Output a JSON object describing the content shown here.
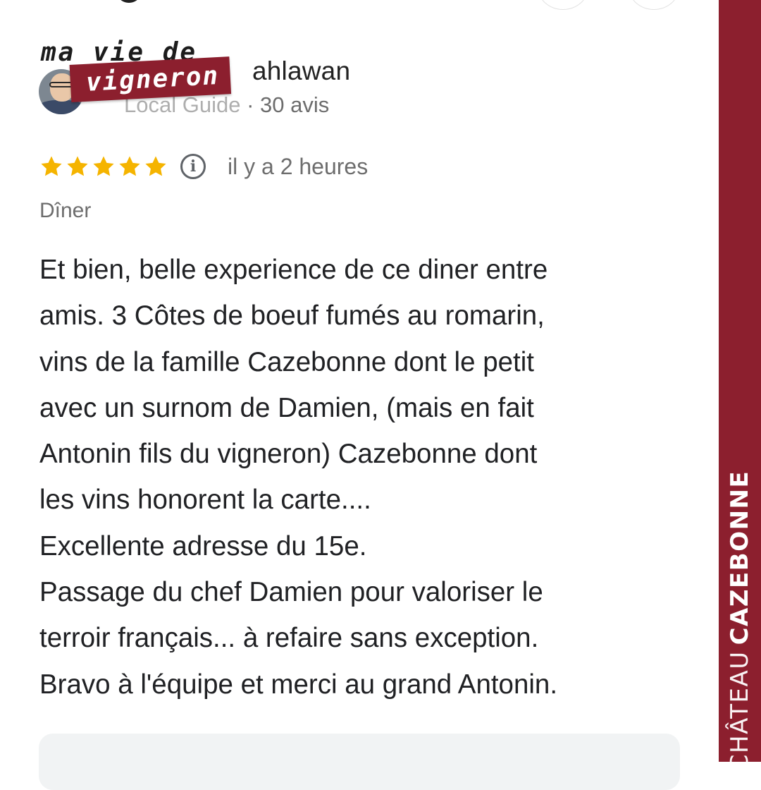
{
  "reviewer": {
    "name_visible": "ahlawan",
    "badge_partial": "Local Guide",
    "review_count": "· 30 avis"
  },
  "overlay": {
    "line1": "ma vie de",
    "line2": "vigneron"
  },
  "rating": {
    "stars": 5,
    "max": 5,
    "time_ago": "il y a 2 heures"
  },
  "visit_type": "Dîner",
  "review_lines": [
    "Et bien, belle experience de ce diner entre",
    "amis. 3 Côtes de boeuf fumés au romarin,",
    "vins de la famille Cazebonne dont le petit",
    "avec un surnom de Damien, (mais en fait",
    "Antonin fils du vigneron) Cazebonne dont",
    "les vins honorent la carte....",
    "Excellente adresse du 15e.",
    "Passage du chef Damien pour valoriser le",
    "terroir français... à refaire sans exception.",
    "Bravo à l'équipe et merci au grand Antonin."
  ],
  "brand": {
    "prefix": "CHÂTEAU",
    "name": "CAZEBONNE"
  },
  "colors": {
    "brand_red": "#8c1f2e",
    "star": "#f5b400",
    "text": "#202124",
    "muted": "#6d6d6d"
  },
  "icons": [
    "star-icon",
    "info-icon"
  ]
}
